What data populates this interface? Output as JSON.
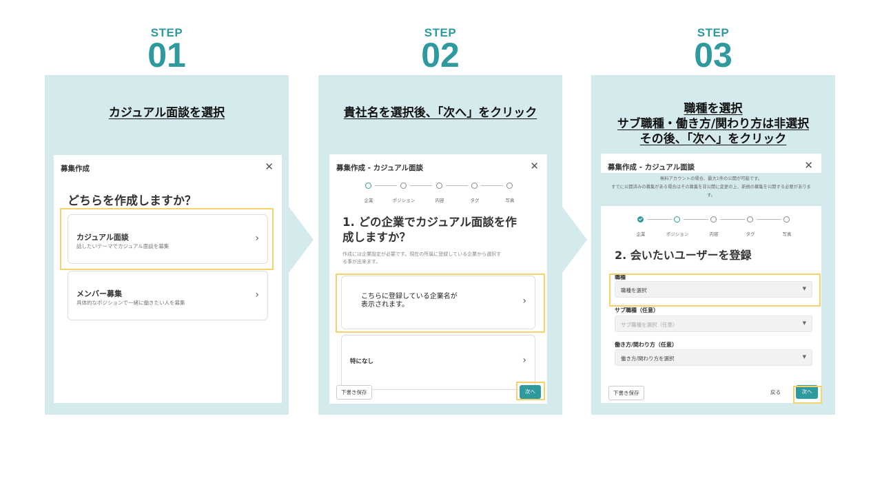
{
  "steps": [
    {
      "label": "STEP",
      "number": "01",
      "instruction": "カジュアル面談を選択",
      "dialog": {
        "title": "募集作成",
        "question": "どちらを作成しますか？",
        "options": [
          {
            "title": "カジュアル面談",
            "subtitle": "話したいテーマでカジュアル面談を募集"
          },
          {
            "title": "メンバー募集",
            "subtitle": "具体的なポジションで一緒に働きたい人を募集"
          }
        ]
      }
    },
    {
      "label": "STEP",
      "number": "02",
      "instruction": "貴社名を選択後、「次へ」をクリック",
      "dialog": {
        "title": "募集作成 - カジュアル面談",
        "stepper": [
          "企業",
          "ポジション",
          "内容",
          "タグ",
          "写真"
        ],
        "question_line1": "1. どの企業でカジュアル面談を作",
        "question_line2": "成しますか？",
        "note_line1": "作成には企業設定が必要です。現在の所属に登録している企業から選択す",
        "note_line2": "る事が出来ます。",
        "company_line1": "こちらに登録している企業名が",
        "company_line2": "表示されます。",
        "none_option": "特になし",
        "draft_button": "下書き保存",
        "next_button": "次へ"
      }
    },
    {
      "label": "STEP",
      "number": "03",
      "instruction_line1": "職種を選択",
      "instruction_line2": "サブ職種・働き方/関わり方は非選択",
      "instruction_line3": "その後、「次へ」をクリック",
      "dialog": {
        "title": "募集作成 - カジュアル面談",
        "banner_line1": "無料アカウントの場合、最大1件の公開が可能です。",
        "banner_line2": "すでに公開済みの募集がある場合はその募集を非公開に変更の上、新規の募集を公開する必要がありま",
        "banner_line3": "す。",
        "stepper": [
          "企業",
          "ポジション",
          "内容",
          "タグ",
          "写真"
        ],
        "heading": "2. 会いたいユーザーを登録",
        "fields": [
          {
            "label": "職種",
            "placeholder": "職種を選択"
          },
          {
            "label": "サブ職種（任意）",
            "placeholder": "サブ職種を選択（任意）"
          },
          {
            "label": "働き方/関わり方（任意）",
            "placeholder": "働き方/関わり方を選択"
          }
        ],
        "draft_button": "下書き保存",
        "back_button": "戻る",
        "next_button": "次へ"
      }
    }
  ],
  "colors": {
    "accent": "#2e9a9d",
    "panel": "#d5eaed",
    "highlight": "#f5d36a"
  },
  "icons": {
    "close": "close-icon",
    "chevron": "chevron-right-icon",
    "caret": "caret-down-icon",
    "check": "check-icon"
  }
}
